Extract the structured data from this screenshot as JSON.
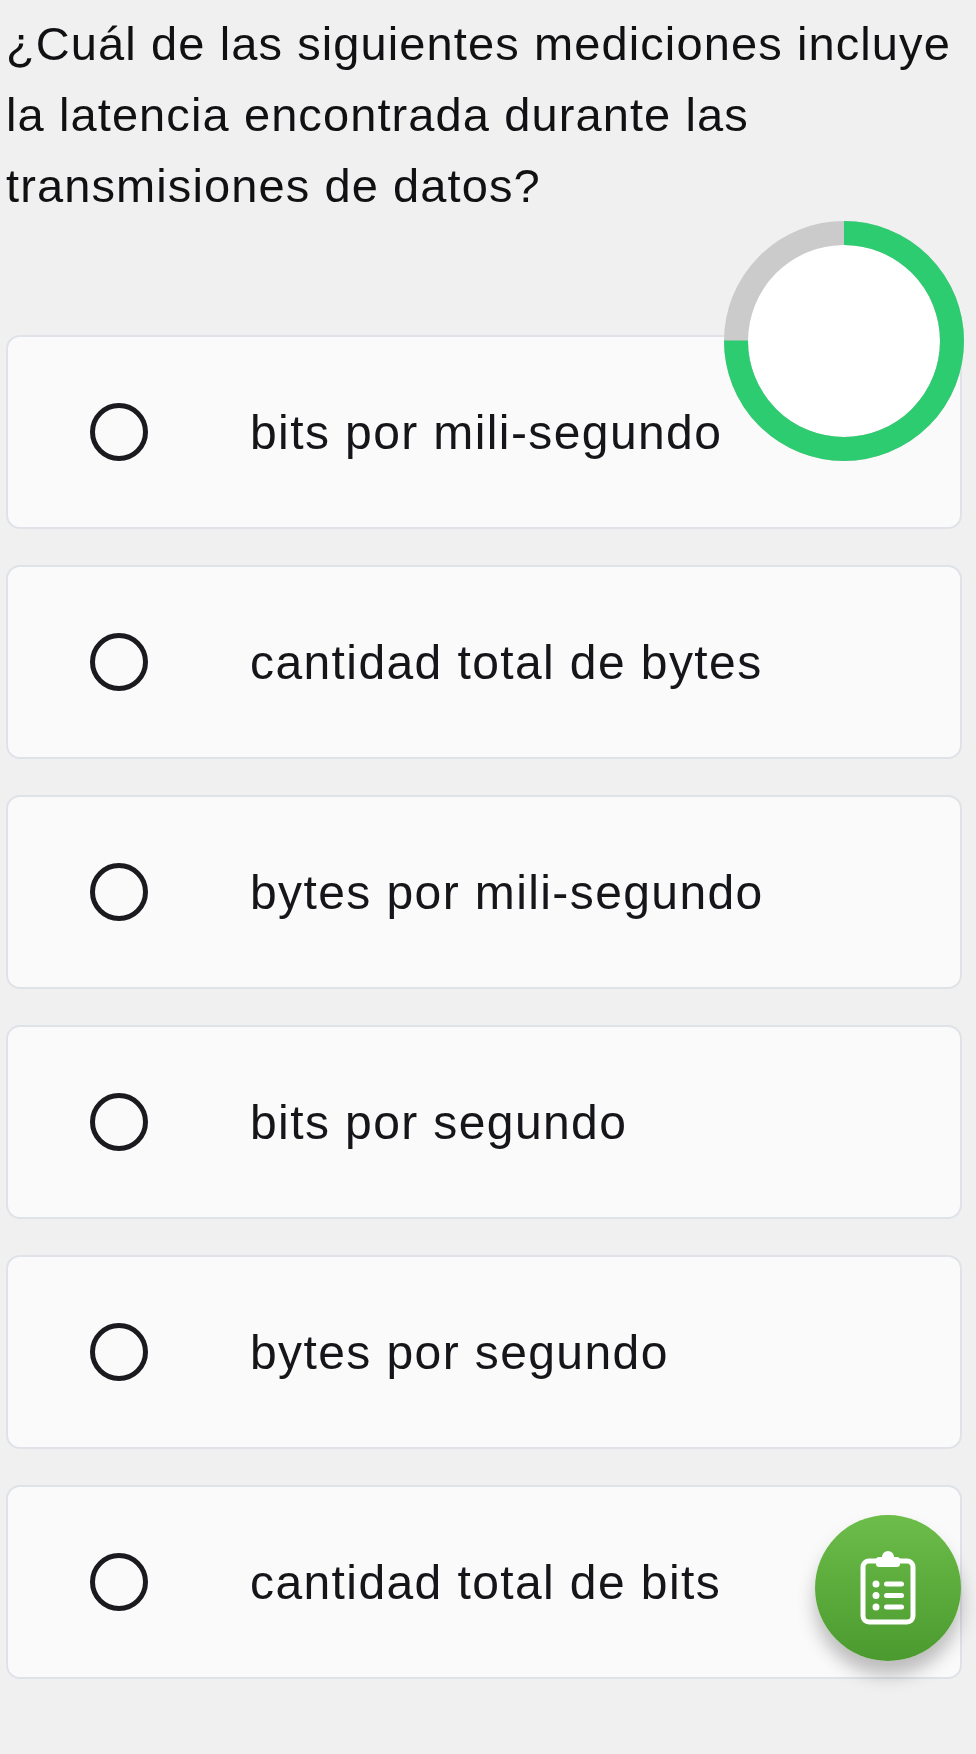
{
  "question": "¿Cuál de las siguientes mediciones incluye la latencia encontrada durante las transmisiones de datos?",
  "timer": {
    "level": 0.75
  },
  "options": [
    {
      "label": "bits por mili-segundo",
      "selected": false
    },
    {
      "label": "cantidad total de bytes",
      "selected": false
    },
    {
      "label": "bytes por mili-segundo",
      "selected": false
    },
    {
      "label": "bits por segundo",
      "selected": false
    },
    {
      "label": "bytes por segundo",
      "selected": false
    },
    {
      "label": "cantidad total de bits",
      "selected": false
    }
  ]
}
